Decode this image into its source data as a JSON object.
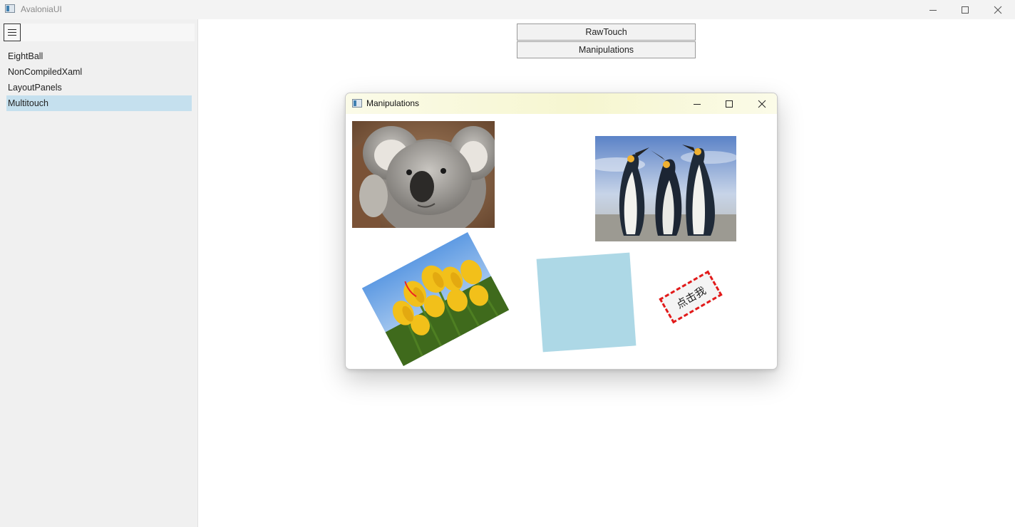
{
  "window": {
    "title": "AvaloniaUI"
  },
  "sidebar": {
    "items": [
      {
        "label": "EightBall"
      },
      {
        "label": "NonCompiledXaml"
      },
      {
        "label": "LayoutPanels"
      },
      {
        "label": "Multitouch",
        "selected": true
      }
    ]
  },
  "main": {
    "buttons": {
      "raw_touch": "RawTouch",
      "manipulations": "Manipulations"
    },
    "child_window": {
      "title": "Manipulations",
      "click_button_label": "点击我",
      "blue_square_color": "#add8e6"
    }
  },
  "icons": {
    "hamburger": "hamburger-icon",
    "minimize": "minimize-icon",
    "maximize": "maximize-icon",
    "close": "close-icon"
  }
}
